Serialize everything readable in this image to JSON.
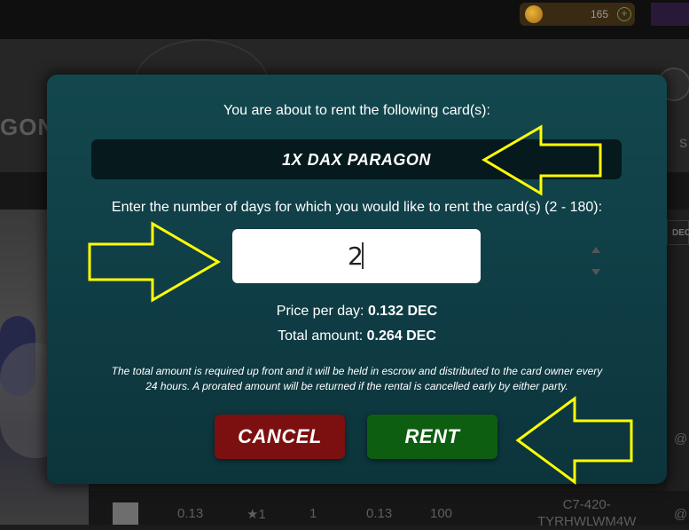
{
  "header": {
    "coin_count": "165",
    "plus_icon": "plus-circle-icon"
  },
  "background": {
    "title_fragment": "GON",
    "side_letter": "S",
    "dec_tab": "DEC",
    "row": [
      "0.13",
      "★1",
      "1",
      "0.13",
      "100"
    ],
    "address": [
      "C7-420-",
      "TYRHWLWM4W"
    ],
    "at_symbol": "@"
  },
  "modal": {
    "intro": "You are about to rent the following card(s):",
    "card_name": "1X DAX PARAGON",
    "days_label": "Enter the number of days for which you would like to rent the card(s) (2 - 180):",
    "days_value": "2",
    "price_per_day_label": "Price per day:",
    "price_per_day_value": "0.132 DEC",
    "total_label": "Total amount:",
    "total_value": "0.264 DEC",
    "note_line1": "The total amount is required up front and it will be held in escrow and distributed to the card owner every",
    "note_line2": "24 hours. A prorated amount will be returned if the rental is cancelled early by either party.",
    "cancel_label": "CANCEL",
    "rent_label": "RENT"
  },
  "colors": {
    "modal_bg": "#13474e",
    "cancel": "#7c1010",
    "rent": "#0e5e12",
    "annotation_arrow": "#ffff00"
  }
}
